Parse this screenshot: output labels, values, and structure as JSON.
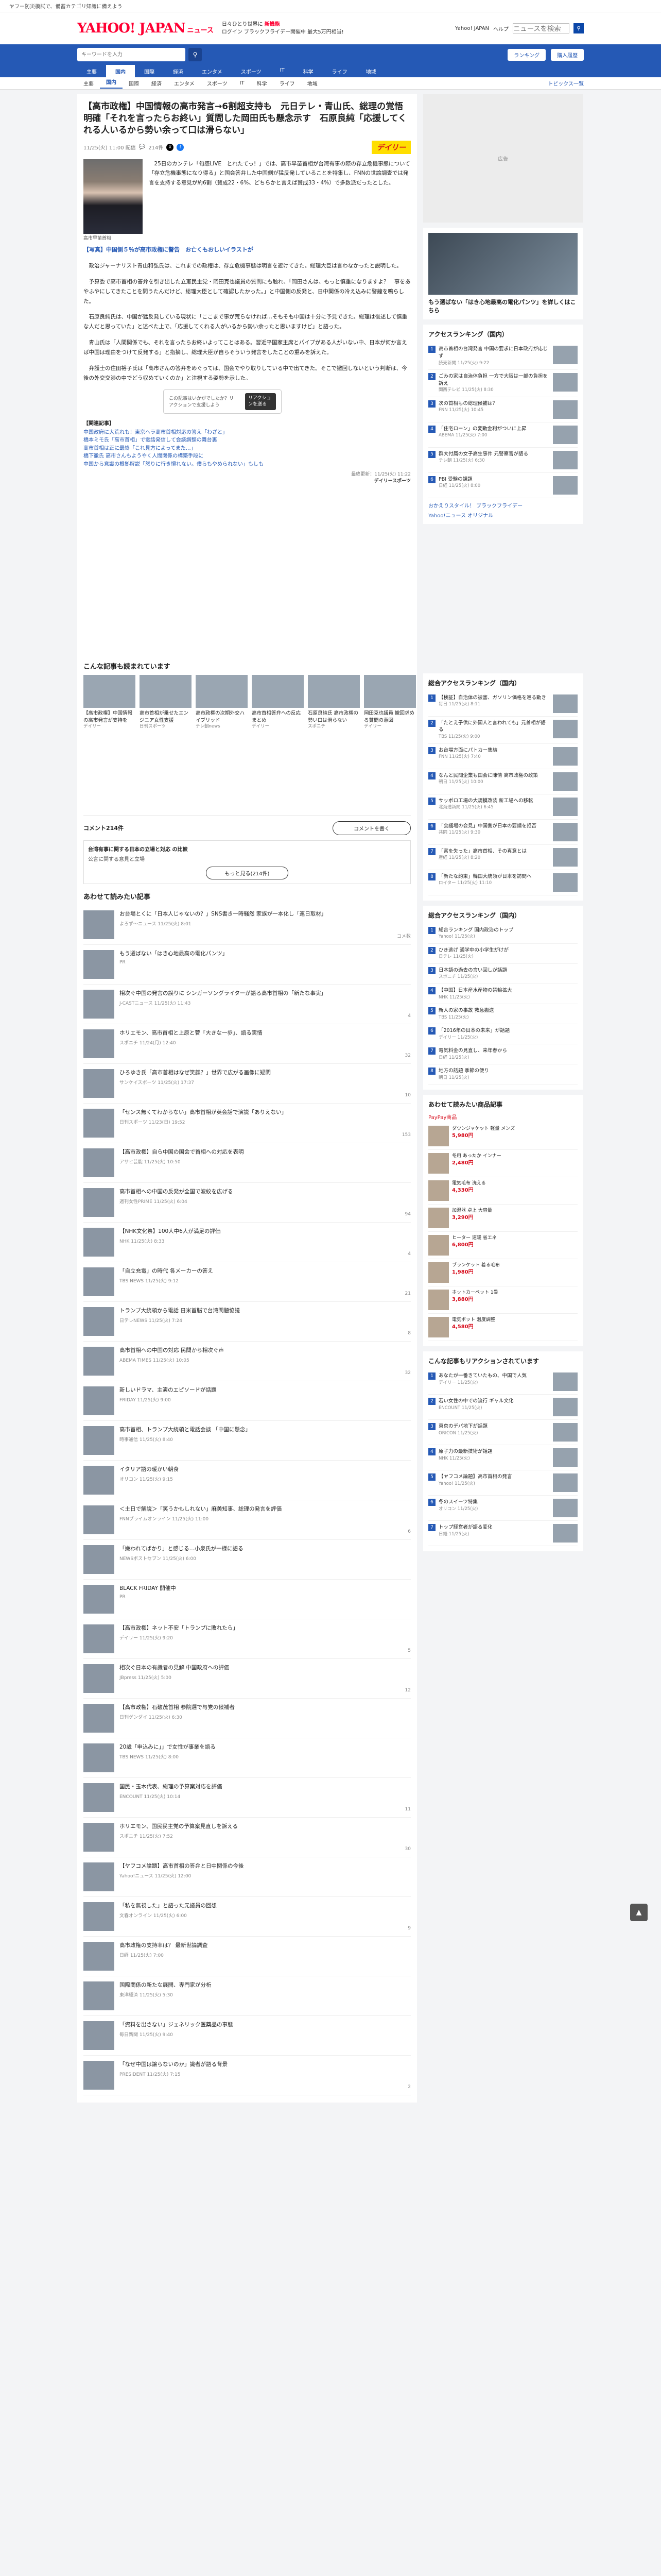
{
  "topline": {
    "text": "ヤフー防災模試で、備蓄カテゴリ知識に備えよう"
  },
  "header": {
    "logo": "YAHOO! JAPAN",
    "logo_sub": "ニュース",
    "promo_line1": "日々ひとり世界に ",
    "promo_hl": "新機能",
    "promo_line2": "ログイン ブラックフライデー開催中 最大5万円相当!",
    "links": [
      "Yahoo! JAPAN",
      "ヘルプ"
    ],
    "search_placeholder": "ニュースを検索"
  },
  "nav": {
    "search_placeholder": "キーワードを入力",
    "search_button": "ニュース検索",
    "right": [
      "ランキング",
      "購入履歴"
    ],
    "tabs": [
      "主要",
      "国内",
      "国際",
      "経済",
      "エンタメ",
      "スポーツ",
      "IT",
      "科学",
      "ライフ",
      "地域"
    ],
    "active_tab": 1,
    "sub_tabs": [
      "主要",
      "国内",
      "国際",
      "経済",
      "エンタメ",
      "スポーツ",
      "IT",
      "科学",
      "ライフ",
      "地域"
    ],
    "sub_right": "トピックス一覧"
  },
  "article": {
    "title": "【高市政権】中国情報の高市発言→6割超支持も　元日テレ・青山氏、総理の覚悟明確「それを言ったらお終い」質問した岡田氏も懸念示す　石原良純「応援してくれる人いるから勢い余って口は滑らない」",
    "date": "11/25(火) 11:00 配信",
    "comments_label": "214件",
    "publisher": "デイリー",
    "photo_caption": "高市早苗首相",
    "lead": "　25日のカンテレ「旬感LIVE　とれたてっ！」では、高市早苗首相が台湾有事の際の存立危機事態について「存立危機事態になり得る」と国会答弁した中国側が猛反発していることを特集し、FNNの世論調査では発言を支持する意見が約6割（賛成22・6%、どちらかと言えば賛成33・4%）で多数派だったとした。",
    "blue_link": "【写真】中国側５％が高市政権に警告　お亡くもおしいイラストが",
    "paragraphs": [
      "　政治ジャーナリスト青山和弘氏は、これまでの政権は、存立危機事態は明言を避けてきた。総理大臣は言わなかったと説明した。",
      "　予算委で高市首相の答弁を引き出した立憲民主党・岡田克也議員の質問にも触れ、「岡田さんは、もっと慎重になりますよ？　事をあやふやにしてきたことを問うたんだけど、総理大臣として確認したかった。」と中国側の反発と、日中関係の冷え込みに警鐘を鳴らした。",
      "　石原良純氏は、中国が猛反発している現状に「ここまで事が荒らなければ…そもそも中国は十分に予見できた。総理は後述して慎重な人だと思っていた」と述べた上で、「応援してくれる人がいるから勢い余ったと思いますけど」と語った。",
      "　青山氏は「人間関係でも、それを言ったらお終いよってことはある。習近平国家主席とパイプがある人がいない中、日本が何か言えば中国は理由をつけて反発する」と指摘し、総理大臣が自らそういう発言をしたことの重みを訴えた。",
      "　弁護士の住田裕子氏は「高市さんの答弁をめぐっては、国会でやり取りしている中で出てきた。そこで撤回しないという判断は、今後の外交交渉の中でどう収めていくのか」と注視する姿勢を示した。"
    ],
    "promo_text": "この記事はいかがでしたか？リアクションで支援しよう",
    "promo_cta": "リアクションを送る",
    "related_header": "【関連記事】",
    "related": [
      "中国政府に大荒れも！東京ヘラ高市首相対応の答え「わざと」",
      "橋本ミモ氏「高市首相」で電話発信して会談調整の舞台裏",
      "高市首相は正に最終「これ見方によってまた…」",
      "橋下徹氏 高市さんもようやく人間関係の構築手段に",
      "中国から意識の根拠解説「怒りに行き慣れない。僕らもやめられない」もしも"
    ],
    "provider": "最終更新：11/25(火) 11:22",
    "provider2": "デイリースポーツ"
  },
  "recommend": {
    "header": "こんな記事も読まれています",
    "items": [
      {
        "title": "【高市政権】中国情報の高市発言が支持を",
        "src": "デイリー"
      },
      {
        "title": "高市首相が乗せたエンジニア女性支援",
        "src": "日刊スポーツ"
      },
      {
        "title": "高市政権の次期外交ハイブリッド",
        "src": "テレ朝news"
      },
      {
        "title": "高市首相答弁への反応まとめ",
        "src": "デイリー"
      },
      {
        "title": "石原良純氏 高市政権の勢い口は滑らない",
        "src": "スポニチ"
      },
      {
        "title": "岡田克也議員 撤回求める質問の意図",
        "src": "デイリー"
      }
    ]
  },
  "comments": {
    "count": "コメント214件",
    "button": "コメントを書く",
    "poll_title": "台湾有事に関する日本の立場と対応 の比較",
    "poll_opt": "公言に関する意見と立場",
    "poll_button": "もっと見る(214件)"
  },
  "feed": {
    "header": "あわせて読みたい記事",
    "items": [
      {
        "title": "お台場とくに「日本人じゃないの？」SNS書き一時騒然 家族が一本化し「連日取材」",
        "src": "よろず〜ニュース 11/25(火) 8:01",
        "c": "コメ数"
      },
      {
        "title": "もう選ばない「はき心地最高の電化パンツ」",
        "src": "PR",
        "c": ""
      },
      {
        "title": "相次ぐ中国の発言の誤りに シンガーソングライターが語る高市首相の「新たな事実」",
        "src": "J-CASTニュース 11/25(火) 11:43",
        "c": "4"
      },
      {
        "title": "ホリエモン、高市首相と上原と菅「大きな一歩」、語る実情",
        "src": "スポニチ 11/24(月) 12:40",
        "c": "32"
      },
      {
        "title": "ひろゆき氏「高市首相はなぜ笑顔？」世界で広がる画像に疑問",
        "src": "サンケイスポーツ 11/25(火) 17:37",
        "c": "10"
      },
      {
        "title": "「センス無くてわからない」高市首相が英会話で演説「ありえない」",
        "src": "日刊スポーツ 11/23(日) 19:52",
        "c": "153"
      },
      {
        "title": "【高市政権】自ら中国の国会で首相への対応を表明",
        "src": "アサヒ芸能 11/25(火) 10:50",
        "c": ""
      },
      {
        "title": "高市首相への中国の反発が全国で波紋を広げる",
        "src": "週刊女性PRIME 11/25(火) 6:04",
        "c": "94"
      },
      {
        "title": "【NHK文化祭】100人中6人が満足の評価",
        "src": "NHK 11/25(火) 8:33",
        "c": "4"
      },
      {
        "title": "「自立充電」の時代 各メーカーの答え",
        "src": "TBS NEWS 11/25(火) 9:12",
        "c": "21"
      },
      {
        "title": "トランプ大統領から電話 日米首脳で台湾問題協議",
        "src": "日テレNEWS 11/25(火) 7:24",
        "c": "8"
      },
      {
        "title": "高市首相への中国の対応 民間から相次ぐ声",
        "src": "ABEMA TIMES 11/25(火) 10:05",
        "c": "32"
      },
      {
        "title": "新しいドラマ、主演のエピソードが話題",
        "src": "FRIDAY 11/25(火) 9:00",
        "c": ""
      },
      {
        "title": "高市首相、トランプ大統領と電話会談 「中国に懸念」",
        "src": "時事通信 11/25(火) 8:40",
        "c": ""
      },
      {
        "title": "イタリア語の暖かい朝食",
        "src": "オリコン 11/25(火) 9:15",
        "c": ""
      },
      {
        "title": "＜土日で解説＞「笑うかもしれない」麻美知事、総理の発言を評価",
        "src": "FNNプライムオンライン 11/25(火) 11:00",
        "c": "6"
      },
      {
        "title": "「嫌われてばかり」と感じる…小泉氏が一様に語る",
        "src": "NEWSポストセブン 11/25(火) 6:00",
        "c": ""
      },
      {
        "title": "BLACK FRIDAY 開催中",
        "src": "PR",
        "c": ""
      },
      {
        "title": "【高市政権】ネット不安「トランプに敗れたら」",
        "src": "デイリー 11/25(火) 9:20",
        "c": "5"
      },
      {
        "title": "相次ぐ日本の有識者の見解 中国政府への評価",
        "src": "JBpress 11/25(火) 5:00",
        "c": "12"
      },
      {
        "title": "【高市政権】石破茂首相 参院選で与党の候補者",
        "src": "日刊ゲンダイ 11/25(火) 6:30",
        "c": ""
      },
      {
        "title": "20歳「申込みに」」で女性が事業を語る",
        "src": "TBS NEWS 11/25(火) 8:00",
        "c": ""
      },
      {
        "title": "国民・玉木代表、総理の予算案対応を評価",
        "src": "ENCOUNT 11/25(火) 10:14",
        "c": "11"
      },
      {
        "title": "ホリエモン、国民民主党の予算案見直しを訴える",
        "src": "スポニチ 11/25(火) 7:52",
        "c": "30"
      },
      {
        "title": "【ヤフコメ論題】高市首相の答弁と日中関係の今後",
        "src": "Yahoo!ニュース 11/25(火) 12:00",
        "c": ""
      },
      {
        "title": "「私を無視した」と語った元議員の回想",
        "src": "文春オンライン 11/25(火) 6:00",
        "c": "9"
      },
      {
        "title": "高市政権の支持率は？ 最新世論調査",
        "src": "日経 11/25(火) 7:00",
        "c": ""
      },
      {
        "title": "国際関係の新たな展開、専門家が分析",
        "src": "東洋経済 11/25(火) 5:30",
        "c": ""
      },
      {
        "title": "「資料を出さない」ジェネリック医薬品の事態",
        "src": "毎日新聞 11/25(火) 9:40",
        "c": ""
      },
      {
        "title": "「なぜ中国は譲らないのか」識者が語る背景",
        "src": "PRESIDENT 11/25(火) 7:15",
        "c": "2"
      }
    ]
  },
  "side": {
    "ad": "広告",
    "tweet_title": "もう選ばない「はき心地最高の電化パンツ」を詳しくはこちら",
    "access_h": "アクセスランキング（国内）",
    "access": [
      {
        "t": "高市首相の台湾発言 中国の要求に日本政府が応じず",
        "s": "読売新聞 11/25(火) 9:22"
      },
      {
        "t": "ごみの家は自治体負担 一方で大阪は一部の負担を訴え",
        "s": "関西テレビ 11/25(火) 8:30"
      },
      {
        "t": "次の首相もの総理候補は？",
        "s": "FNN 11/25(火) 10:45"
      },
      {
        "t": "「住宅ローン」の変動金利がついに上昇",
        "s": "ABEMA 11/25(火) 7:00"
      },
      {
        "t": "群大付属の女子高生事件 元警察官が語る",
        "s": "テレ朝 11/25(火) 6:30"
      },
      {
        "t": "PBI 受験の課題",
        "s": "日経 11/25(火) 8:00"
      }
    ],
    "yahoo_list": [
      "おかえりスタイル！ ブラックフライデー",
      "Yahoo!ニュース オリジナル"
    ],
    "comment_h": "総合アクセスランキング（国内）",
    "comment_rank": [
      {
        "t": "【検証】自治体の被害、ガソリン価格を巡る動き",
        "s": "毎日 11/25(火) 8:11"
      },
      {
        "t": "「たとえ子供に外国人と言われても」元首相が語る",
        "s": "TBS 11/25(火) 9:00"
      },
      {
        "t": "お台場方面にパトカー集結",
        "s": "FNN 11/25(火) 7:40"
      },
      {
        "t": "なんと民間企業も国会に陳情 高市政権の政策",
        "s": "朝日 11/25(火) 10:00"
      },
      {
        "t": "サッポロ工場の大規模改装 新工場への移転",
        "s": "北海道新聞 11/25(火) 6:45"
      },
      {
        "t": "「会議場の会見」中国側が日本の要請を拒否",
        "s": "共同 11/25(火) 9:30"
      },
      {
        "t": "「富を失った」高市首相、その真意とは",
        "s": "産経 11/25(火) 8:20"
      },
      {
        "t": "「新たな約束」韓国大統領が日本を訪問へ",
        "s": "ロイター 11/25(火) 11:10"
      }
    ],
    "topic_h": "総合アクセスランキング（国内）",
    "topic_rank": [
      {
        "t": "総合ランキング 国内政治のトップ",
        "s": "Yahoo! 11/25(火)"
      },
      {
        "t": "ひき逃げ 通学中の小学生がけが",
        "s": "日テレ 11/25(火)"
      },
      {
        "t": "日本語の過去の言い回しが話題",
        "s": "スポニチ 11/25(火)"
      },
      {
        "t": "【中国】日本産水産物の禁輸拡大",
        "s": "NHK 11/25(火)"
      },
      {
        "t": "新人の家の事故 救急搬送",
        "s": "TBS 11/25(火)"
      },
      {
        "t": "「2016年の日本の未来」が話題",
        "s": "デイリー 11/25(火)"
      },
      {
        "t": "電気料金の見直し、来年春から",
        "s": "日経 11/25(火)"
      },
      {
        "t": "地方の話題 季節の便り",
        "s": "朝日 11/25(火)"
      }
    ],
    "shop_h": "あわせて読みたい商品記事",
    "shop_sub": "PayPay商品",
    "shop": [
      {
        "t": "ダウンジャケット 軽量 メンズ",
        "p": "5,980円"
      },
      {
        "t": "冬用 あったか インナー",
        "p": "2,480円"
      },
      {
        "t": "電気毛布 洗える",
        "p": "4,330円"
      },
      {
        "t": "加湿器 卓上 大容量",
        "p": "3,290円"
      },
      {
        "t": "ヒーター 速暖 省エネ",
        "p": "6,800円"
      },
      {
        "t": "ブランケット 着る毛布",
        "p": "1,980円"
      },
      {
        "t": "ホットカーペット 1畳",
        "p": "3,880円"
      },
      {
        "t": "電気ポット 温度調整",
        "p": "4,580円"
      }
    ],
    "reaction_h": "こんな記事もリアクションされています",
    "reaction": [
      {
        "t": "あなたが一番きていたもの、中国で人気",
        "s": "デイリー 11/25(火)"
      },
      {
        "t": "若い女性の中での流行 ギャル文化",
        "s": "ENCOUNT 11/25(火)"
      },
      {
        "t": "東京のデパ地下が話題",
        "s": "ORICON 11/25(火)"
      },
      {
        "t": "原子力の最新技術が話題",
        "s": "NHK 11/25(火)"
      },
      {
        "t": "【ヤフコメ論題】高市首相の発言",
        "s": "Yahoo! 11/25(火)"
      },
      {
        "t": "冬のスイーツ特集",
        "s": "オリコン 11/25(火)"
      },
      {
        "t": "トップ経営者が語る変化",
        "s": "日経 11/25(火)"
      }
    ]
  },
  "pagetop": "▲"
}
